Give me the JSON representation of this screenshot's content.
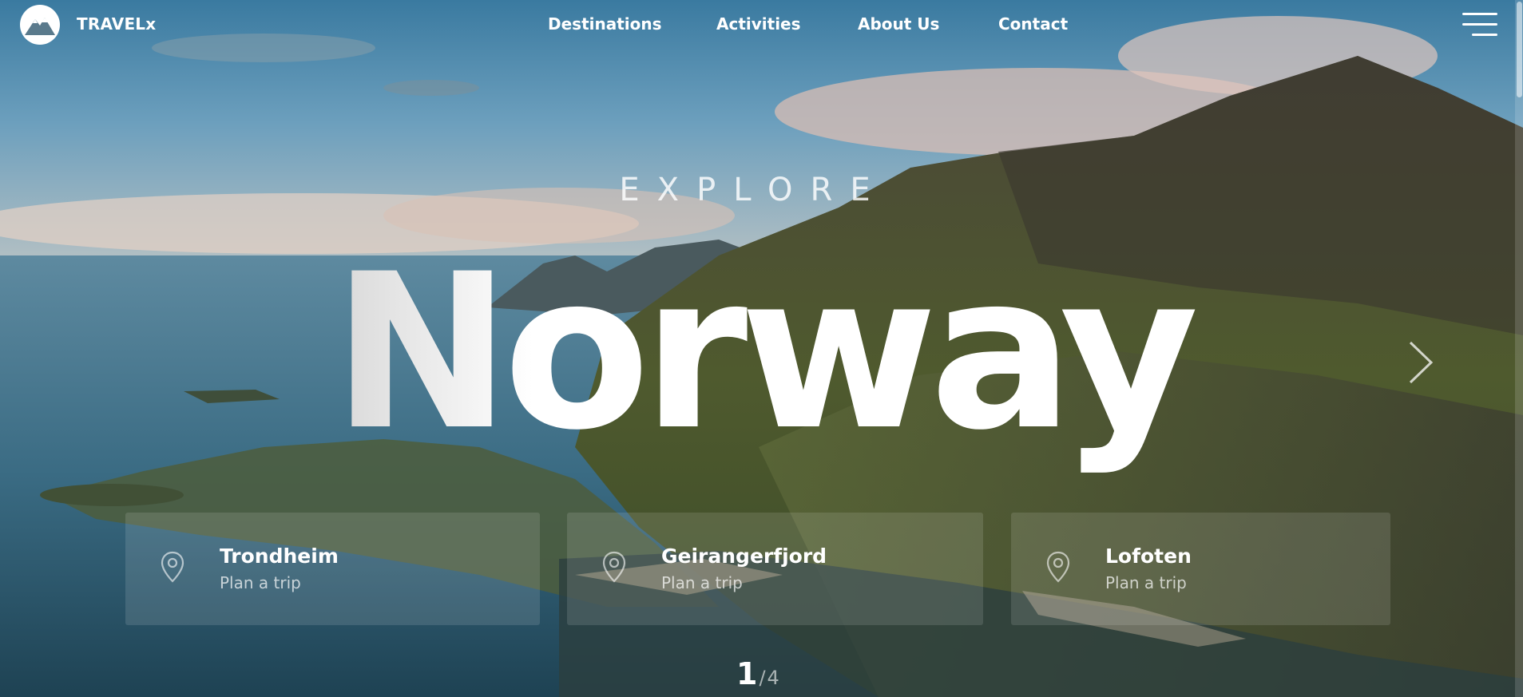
{
  "header": {
    "brand": "TRAVELx",
    "nav": [
      "Destinations",
      "Activities",
      "About Us",
      "Contact"
    ]
  },
  "hero": {
    "kicker": "EXPLORE",
    "title": "Norway"
  },
  "cards": [
    {
      "name": "Trondheim",
      "action": "Plan a trip"
    },
    {
      "name": "Geirangerfjord",
      "action": "Plan a trip"
    },
    {
      "name": "Lofoten",
      "action": "Plan a trip"
    }
  ],
  "pager": {
    "current": "1",
    "separator": "/",
    "total": "4"
  },
  "icons": {
    "logo": "mountain-logo-icon",
    "menu": "hamburger-menu-icon",
    "next": "chevron-right-icon",
    "card": "map-pin-icon"
  }
}
